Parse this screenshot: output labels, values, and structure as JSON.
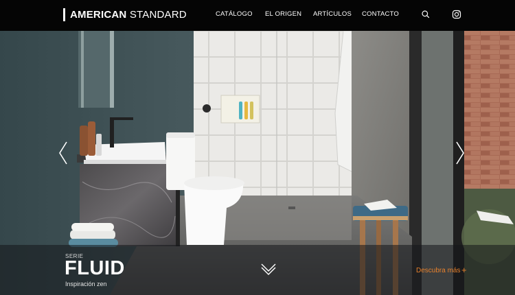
{
  "header": {
    "logo_bold": "AMERICAN",
    "logo_light": "STANDARD",
    "nav": [
      {
        "label": "CATÁLOGO"
      },
      {
        "label": "EL ORIGEN"
      },
      {
        "label": "ARTÍCULOS"
      },
      {
        "label": "CONTACTO"
      }
    ],
    "icons": [
      "search-icon",
      "instagram-icon"
    ]
  },
  "hero": {
    "serie_label": "SERIE",
    "serie_name": "FLUID",
    "tagline": "Inspiración zen",
    "cta": "Descubra más",
    "cta_symbol": "+",
    "icons": [
      "chevron-left-icon",
      "chevron-right-icon",
      "chevron-down-icon"
    ]
  },
  "colors": {
    "header_bg": "#050505",
    "accent": "#e8812c",
    "wall_teal": "#3f5257",
    "tile_white": "#ecebe8"
  }
}
